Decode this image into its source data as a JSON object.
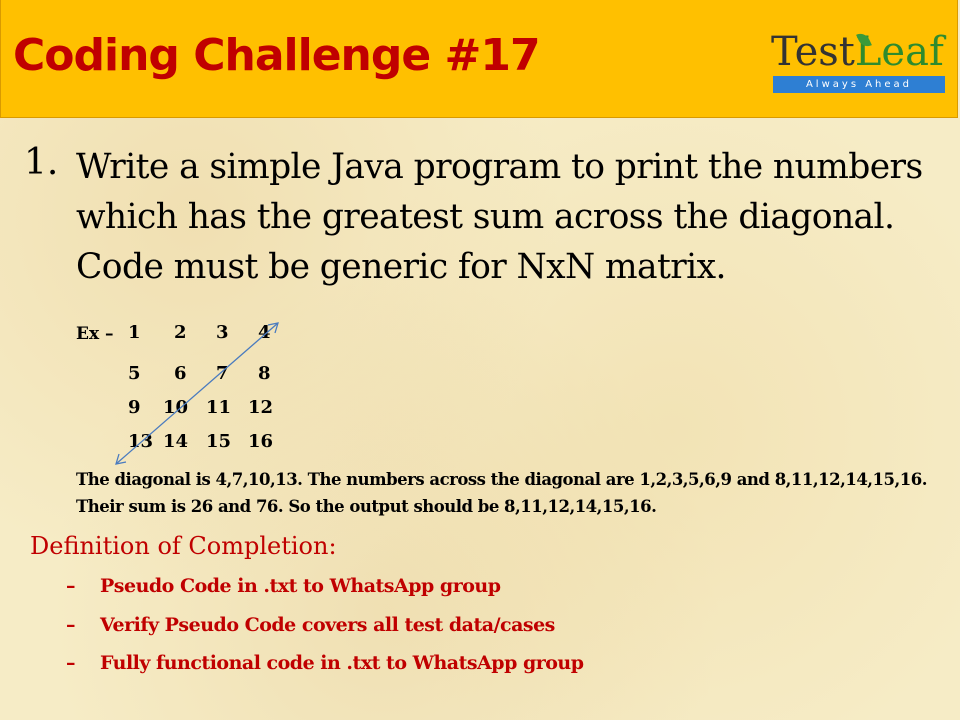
{
  "header": {
    "title": "Coding Challenge #17",
    "logo": {
      "name_part1": "Test",
      "name_part2": "Leaf",
      "tagline": "Always Ahead"
    }
  },
  "problem": {
    "number": "1.",
    "text": "Write a simple Java program to print the numbers which has the greatest sum across the diagonal. Code must be generic for NxN matrix."
  },
  "example": {
    "label": "Ex –",
    "matrix": [
      [
        "1",
        "2",
        "3",
        "4"
      ],
      [
        "5",
        "6",
        "7",
        "8"
      ],
      [
        "9",
        "10",
        "11",
        "12"
      ],
      [
        "13",
        "14",
        "15",
        "16"
      ]
    ],
    "explanation": "The diagonal is 4,7,10,13.  The numbers across the diagonal are 1,2,3,5,6,9 and 8,11,12,14,15,16. Their sum is 26 and 76. So the output should be 8,11,12,14,15,16."
  },
  "completion": {
    "heading": "Definition of Completion:",
    "dash": "–",
    "items": [
      "Pseudo Code in .txt to WhatsApp group",
      "Verify Pseudo Code covers all test data/cases",
      "Fully functional code in .txt to  WhatsApp group"
    ]
  },
  "colors": {
    "header_bg": "#ffc000",
    "title": "#c00000",
    "accent_red": "#c00000",
    "logo_bar": "#2e7fd3",
    "diagonal_line": "#4a7bbf"
  }
}
